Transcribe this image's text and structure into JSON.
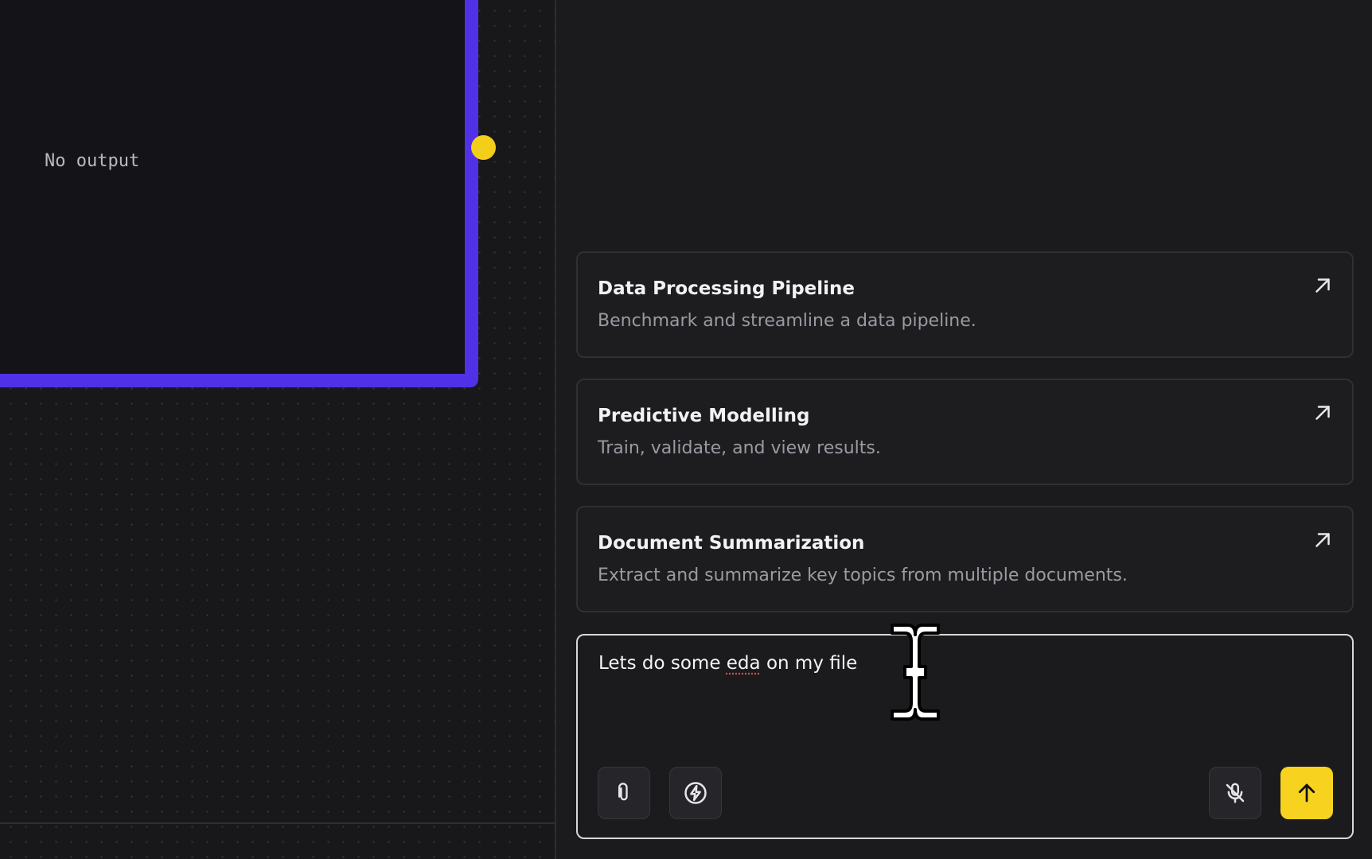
{
  "canvas": {
    "output_placeholder": "No output"
  },
  "suggestions": [
    {
      "title": "Data Processing Pipeline",
      "description": "Benchmark and streamline a data pipeline."
    },
    {
      "title": "Predictive Modelling",
      "description": "Train, validate, and view results."
    },
    {
      "title": "Document Summarization",
      "description": "Extract and summarize key topics from multiple documents."
    }
  ],
  "chat_input": {
    "text_before": "Lets do some ",
    "misspelled_word": "eda",
    "text_after": " on my file"
  },
  "toolbar": {
    "attach": "paperclip-icon",
    "quick_action": "lightning-icon",
    "mic": "mic-off-icon",
    "send": "arrow-up-icon"
  },
  "colors": {
    "accent_purple": "#5131e8",
    "connector_yellow": "#f4cf1a",
    "send_yellow": "#f7d320"
  }
}
